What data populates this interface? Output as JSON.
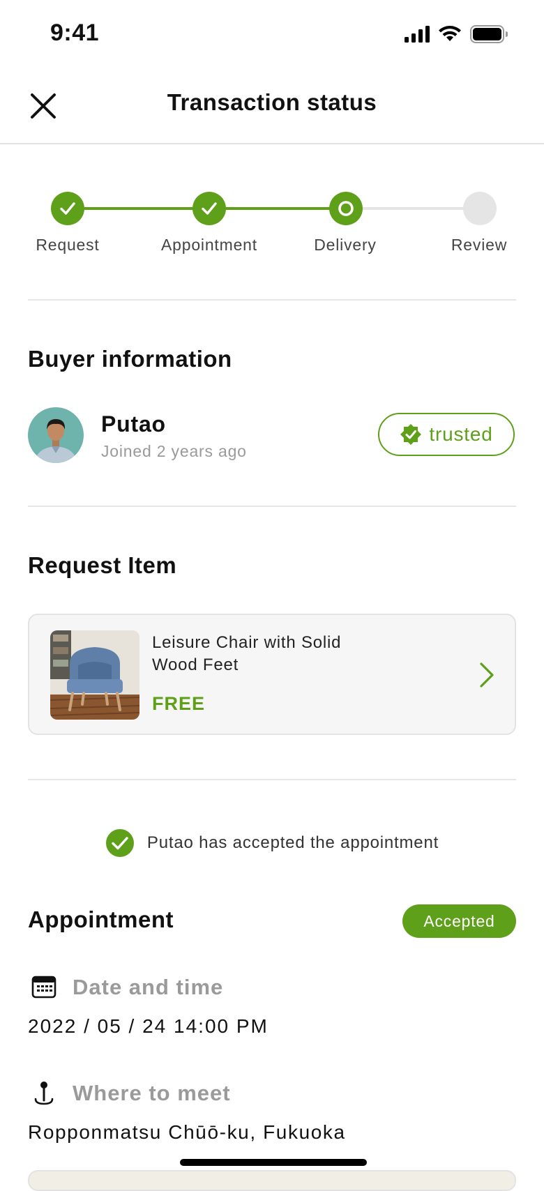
{
  "status_bar": {
    "time": "9:41"
  },
  "header": {
    "title": "Transaction status"
  },
  "stepper": {
    "steps": [
      {
        "label": "Request",
        "state": "done"
      },
      {
        "label": "Appointment",
        "state": "done"
      },
      {
        "label": "Delivery",
        "state": "current"
      },
      {
        "label": "Review",
        "state": "pending"
      }
    ]
  },
  "buyer": {
    "section_title": "Buyer information",
    "name": "Putao",
    "joined": "Joined 2 years ago",
    "badge": "trusted"
  },
  "request_item": {
    "section_title": "Request Item",
    "name": "Leisure Chair with Solid Wood Feet",
    "price": "FREE"
  },
  "notice": {
    "text": "Putao has accepted the appointment"
  },
  "appointment": {
    "section_title": "Appointment",
    "status": "Accepted",
    "date_label": "Date and time",
    "date_value": "2022 / 05 / 24  14:00 PM",
    "place_label": "Where to meet",
    "place_value": "Ropponmatsu Chūō-ku, Fukuoka"
  },
  "colors": {
    "accent": "#5fa01a",
    "muted": "#9a9a9a",
    "divider": "#e6e6e6"
  },
  "icons": [
    "close-icon",
    "check-icon",
    "verified-badge-icon",
    "chevron-right-icon",
    "calendar-icon",
    "location-pin-icon",
    "signal-icon",
    "wifi-icon",
    "battery-icon"
  ]
}
